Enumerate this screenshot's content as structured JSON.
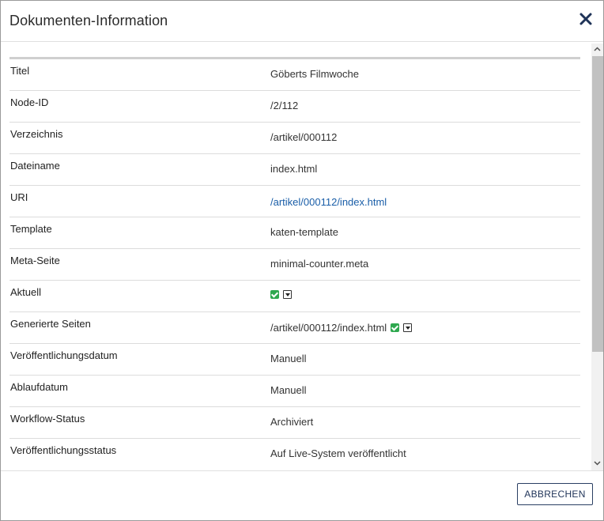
{
  "dialog": {
    "title": "Dokumenten-Information",
    "close_icon": "close-icon",
    "cancel_label": "ABBRECHEN"
  },
  "rows": [
    {
      "label": "Titel",
      "value": "Göberts Filmwoche"
    },
    {
      "label": "Node-ID",
      "value": "/2/112"
    },
    {
      "label": "Verzeichnis",
      "value": "/artikel/000112"
    },
    {
      "label": "Dateiname",
      "value": "index.html"
    },
    {
      "label": "URI",
      "value": "/artikel/000112/index.html"
    },
    {
      "label": "Template",
      "value": "katen-template"
    },
    {
      "label": "Meta-Seite",
      "value": "minimal-counter.meta"
    },
    {
      "label": "Aktuell",
      "value": ""
    },
    {
      "label": "Generierte Seiten",
      "value": "/artikel/000112/index.html"
    },
    {
      "label": "Veröffentlichungsdatum",
      "value": "Manuell"
    },
    {
      "label": "Ablaufdatum",
      "value": "Manuell"
    },
    {
      "label": "Workflow-Status",
      "value": "Archiviert"
    },
    {
      "label": "Veröffentlichungsstatus",
      "value": "Auf Live-System veröffentlicht"
    }
  ],
  "colors": {
    "link": "#1a5ea8",
    "check": "#2fa84f",
    "button_border": "#2a3f63"
  }
}
